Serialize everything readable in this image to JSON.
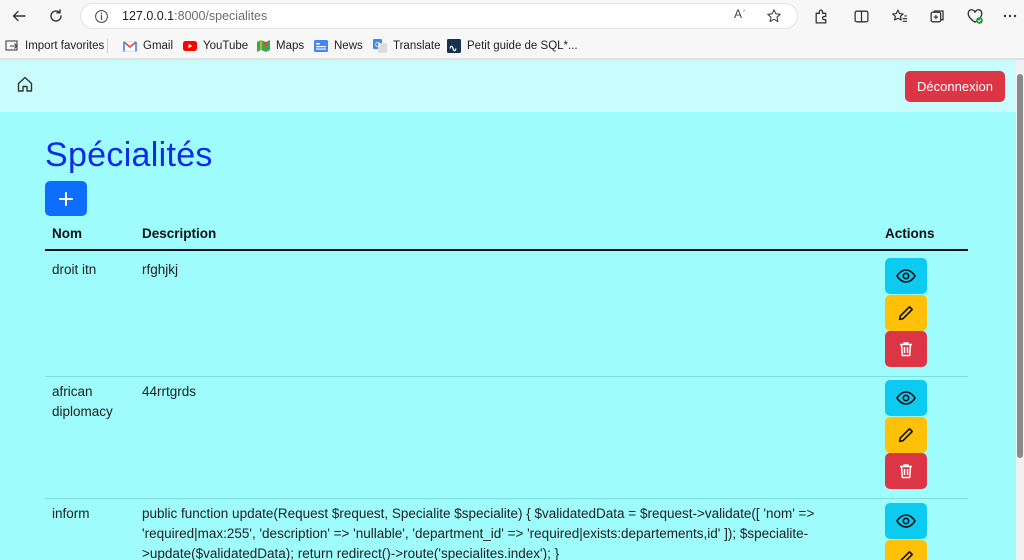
{
  "browser": {
    "url_host": "127.0.0.1",
    "url_rest": ":8000/specialites",
    "read_aloud_label": "Aʾ",
    "bookmarks": [
      {
        "label": "Import favorites",
        "icon": "import-icon"
      },
      {
        "label": "Gmail",
        "icon": "gmail-icon"
      },
      {
        "label": "YouTube",
        "icon": "youtube-icon"
      },
      {
        "label": "Maps",
        "icon": "maps-icon"
      },
      {
        "label": "News",
        "icon": "news-icon"
      },
      {
        "label": "Translate",
        "icon": "translate-icon"
      },
      {
        "label": "Petit guide de SQL*...",
        "icon": "sql-guide-icon"
      }
    ]
  },
  "header": {
    "logout_label": "Déconnexion"
  },
  "main": {
    "title": "Spécialités",
    "add_label": "+",
    "columns": {
      "name": "Nom",
      "description": "Description",
      "actions": "Actions"
    },
    "rows": [
      {
        "name": "droit itn",
        "description": "rfghjkj"
      },
      {
        "name": "african diplomacy",
        "description": "44rrtgrds"
      },
      {
        "name": "inform",
        "description": "public function update(Request $request, Specialite $specialite) { $validatedData = $request->validate([ 'nom' => 'required|max:255', 'description' => 'nullable', 'department_id' => 'required|exists:departements,id' ]); $specialite->update($validatedData); return redirect()->route('specialites.index'); }"
      }
    ]
  },
  "colors": {
    "page_bg": "#9efcfc",
    "topbar_bg": "#c9fdfd",
    "title": "#0d2be8",
    "primary": "#0d6efd",
    "info": "#0dcaf0",
    "warning": "#ffc107",
    "danger": "#dc3545"
  }
}
